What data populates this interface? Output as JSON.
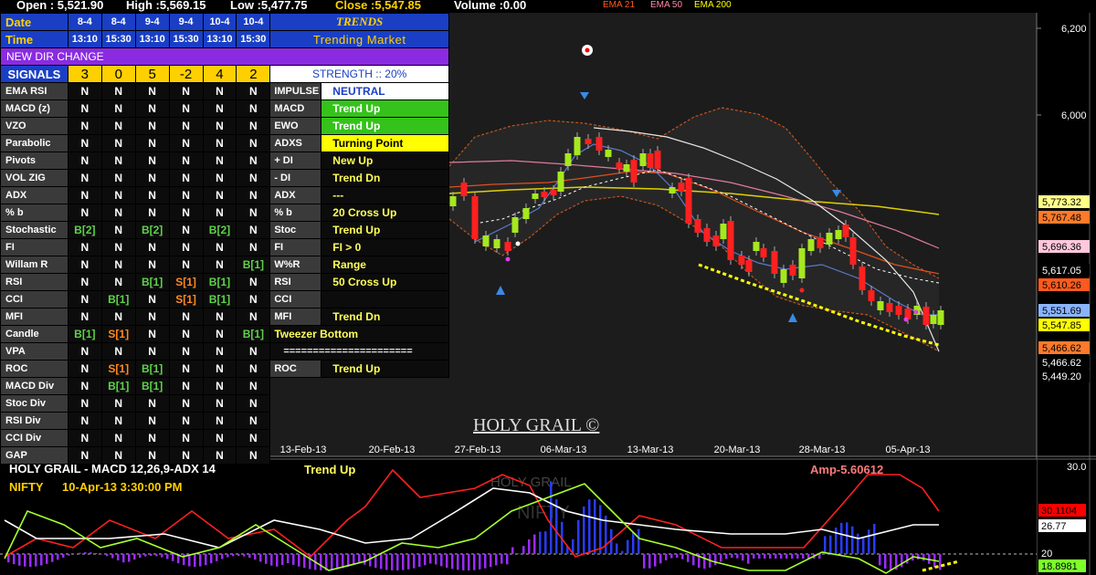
{
  "topbar": {
    "open": "Open : 5,521.90",
    "high": "High :5,569.15",
    "low": "Low :5,477.75",
    "close": "Close :5,547.85",
    "volume": "Volume :0.00",
    "ema21": "EMA 21",
    "ema50": "EMA 50",
    "ema200": "EMA 200"
  },
  "header": {
    "date_label": "Date",
    "time_label": "Time",
    "dates": [
      "8-4",
      "8-4",
      "9-4",
      "9-4",
      "10-4",
      "10-4"
    ],
    "times": [
      "13:10",
      "15:30",
      "13:10",
      "15:30",
      "13:10",
      "15:30"
    ],
    "trends_title": "TRENDS",
    "trends_sub": "Trending Market",
    "new_dir": "NEW DIR CHANGE",
    "signals_label": "SIGNALS",
    "signal_counts": [
      "3",
      "0",
      "5",
      "-2",
      "4",
      "2"
    ],
    "strength": "STRENGTH :: 20%"
  },
  "rows": [
    {
      "label": "EMA RSI",
      "vals": [
        "N",
        "N",
        "N",
        "N",
        "N",
        "N"
      ]
    },
    {
      "label": "MACD (z)",
      "vals": [
        "N",
        "N",
        "N",
        "N",
        "N",
        "N"
      ]
    },
    {
      "label": "VZO",
      "vals": [
        "N",
        "N",
        "N",
        "N",
        "N",
        "N"
      ]
    },
    {
      "label": "Parabolic",
      "vals": [
        "N",
        "N",
        "N",
        "N",
        "N",
        "N"
      ]
    },
    {
      "label": "Pivots",
      "vals": [
        "N",
        "N",
        "N",
        "N",
        "N",
        "N"
      ]
    },
    {
      "label": "VOL ZIG",
      "vals": [
        "N",
        "N",
        "N",
        "N",
        "N",
        "N"
      ]
    },
    {
      "label": "ADX",
      "vals": [
        "N",
        "N",
        "N",
        "N",
        "N",
        "N"
      ]
    },
    {
      "label": "% b",
      "vals": [
        "N",
        "N",
        "N",
        "N",
        "N",
        "N"
      ]
    },
    {
      "label": "Stochastic",
      "vals": [
        "B[2]",
        "N",
        "B[2]",
        "N",
        "B[2]",
        "N"
      ]
    },
    {
      "label": "FI",
      "vals": [
        "N",
        "N",
        "N",
        "N",
        "N",
        "N"
      ]
    },
    {
      "label": "Willam R",
      "vals": [
        "N",
        "N",
        "N",
        "N",
        "N",
        "B[1]"
      ]
    },
    {
      "label": "RSI",
      "vals": [
        "N",
        "N",
        "B[1]",
        "S[1]",
        "B[1]",
        "N"
      ]
    },
    {
      "label": "CCI",
      "vals": [
        "N",
        "B[1]",
        "N",
        "S[1]",
        "B[1]",
        "N"
      ]
    },
    {
      "label": "MFI",
      "vals": [
        "N",
        "N",
        "N",
        "N",
        "N",
        "N"
      ]
    },
    {
      "label": "Candle",
      "vals": [
        "B[1]",
        "S[1]",
        "N",
        "N",
        "N",
        "B[1]"
      ]
    },
    {
      "label": "VPA",
      "vals": [
        "N",
        "N",
        "N",
        "N",
        "N",
        "N"
      ]
    },
    {
      "label": "ROC",
      "vals": [
        "N",
        "S[1]",
        "B[1]",
        "N",
        "N",
        "N"
      ]
    },
    {
      "label": "MACD Div",
      "vals": [
        "N",
        "B[1]",
        "B[1]",
        "N",
        "N",
        "N"
      ]
    },
    {
      "label": "Stoc Div",
      "vals": [
        "N",
        "N",
        "N",
        "N",
        "N",
        "N"
      ]
    },
    {
      "label": "RSI Div",
      "vals": [
        "N",
        "N",
        "N",
        "N",
        "N",
        "N"
      ]
    },
    {
      "label": "CCI Div",
      "vals": [
        "N",
        "N",
        "N",
        "N",
        "N",
        "N"
      ]
    },
    {
      "label": "GAP",
      "vals": [
        "N",
        "N",
        "N",
        "N",
        "N",
        "N"
      ]
    }
  ],
  "indicators": [
    {
      "label": "IMPULSE",
      "status": "NEUTRAL",
      "style": "white"
    },
    {
      "label": "MACD",
      "status": "Trend Up",
      "style": "green"
    },
    {
      "label": "EWO",
      "status": "Trend Up",
      "style": "green"
    },
    {
      "label": "ADXS",
      "status": "Turning Point",
      "style": "yellow"
    },
    {
      "label": "+ DI",
      "status": "New Up",
      "style": "plain"
    },
    {
      "label": "- DI",
      "status": "Trend Dn",
      "style": "plain"
    },
    {
      "label": "ADX",
      "status": "---",
      "style": "plain"
    },
    {
      "label": "% b",
      "status": "20 Cross Up",
      "style": "plain"
    },
    {
      "label": "Stoc",
      "status": "Trend Up",
      "style": "plain"
    },
    {
      "label": "FI",
      "status": "FI > 0",
      "style": "plain"
    },
    {
      "label": "W%R",
      "status": "Range",
      "style": "plain"
    },
    {
      "label": "RSI",
      "status": "50 Cross Up",
      "style": "plain"
    },
    {
      "label": "CCI",
      "status": "",
      "style": "plain"
    },
    {
      "label": "MFI",
      "status": "Trend Dn",
      "style": "plain"
    },
    {
      "label": "",
      "status": "Tweezer Bottom",
      "style": "wide"
    },
    {
      "label": "",
      "status": "======================",
      "style": "wide"
    },
    {
      "label": "ROC",
      "status": "Trend Up",
      "style": "plain"
    }
  ],
  "main_chart": {
    "watermark": "HOLY GRAIL ©",
    "x_ticks": [
      "13-Feb-13",
      "20-Feb-13",
      "27-Feb-13",
      "06-Mar-13",
      "13-Mar-13",
      "20-Mar-13",
      "28-Mar-13",
      "05-Apr-13"
    ],
    "y_ticks": [
      "6,200",
      "6,000"
    ],
    "price_tags": [
      {
        "text": "5,773.32",
        "bg": "#ffff88",
        "fg": "#000"
      },
      {
        "text": "5,767.48",
        "bg": "#ff7a2a",
        "fg": "#000"
      },
      {
        "text": "5,696.36",
        "bg": "#ffc8dc",
        "fg": "#000"
      },
      {
        "text": "5,617.05",
        "bg": "#000000",
        "fg": "#fff"
      },
      {
        "text": "5,610.26",
        "bg": "#ff5a1e",
        "fg": "#000"
      },
      {
        "text": "5,551.69",
        "bg": "#8ab4ff",
        "fg": "#000"
      },
      {
        "text": "5,547.85",
        "bg": "#ffff00",
        "fg": "#000"
      },
      {
        "text": "5,466.62",
        "bg": "#ff7a2a",
        "fg": "#000"
      },
      {
        "text": "5,466.62",
        "bg": "#000000",
        "fg": "#fff"
      },
      {
        "text": "5,449.20",
        "bg": "#000000",
        "fg": "#fff"
      }
    ]
  },
  "lower_chart": {
    "title": "HOLY GRAIL - MACD 12,26,9-ADX 14",
    "trend": "Trend Up",
    "symbol": "NIFTY",
    "datetime": "10-Apr-13 3:30:00 PM",
    "amp": "Amp-5.60612",
    "watermark1": "HOLY GRAIL",
    "watermark2": "NIFTY",
    "y_ticks": [
      "30.0",
      "20.0"
    ],
    "tags": [
      {
        "text": "30.1104",
        "bg": "#ff0000",
        "fg": "#000"
      },
      {
        "text": "26.77",
        "bg": "#ffffff",
        "fg": "#000"
      },
      {
        "text": "20",
        "bg": "#000",
        "fg": "#fff"
      },
      {
        "text": "18.8981",
        "bg": "#7cff2a",
        "fg": "#000"
      }
    ]
  },
  "colors": {
    "header_blue": "#1a3fc4",
    "signal_yellow": "#ffd000",
    "buy_green": "#5ed24a",
    "sell_orange": "#ff8a1e",
    "trend_green": "#35c21a"
  }
}
